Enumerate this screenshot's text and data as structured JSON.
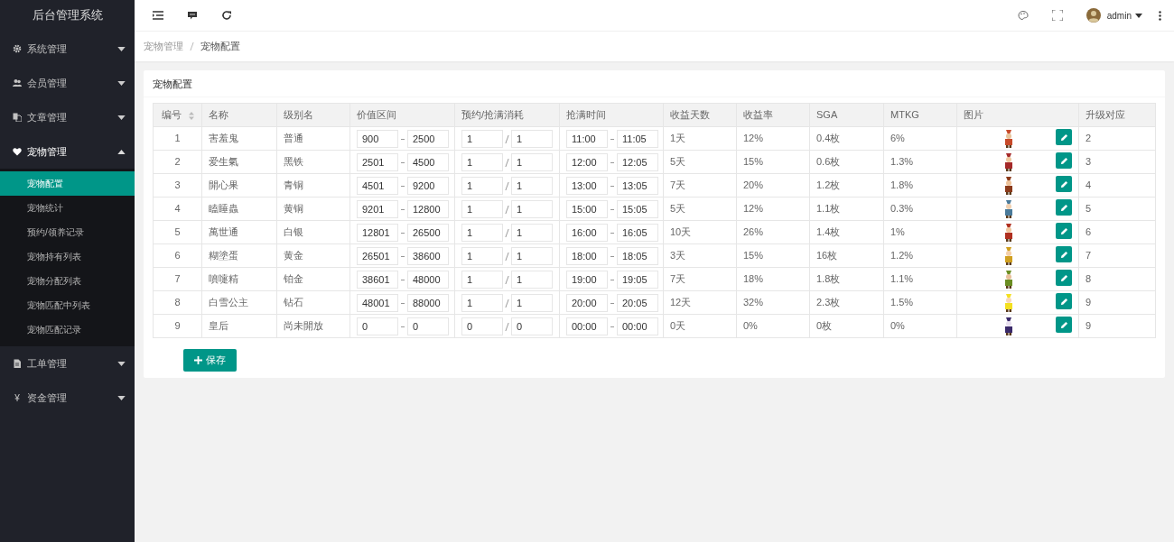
{
  "sidebar": {
    "title": "后台管理系统",
    "items": [
      {
        "label": "系统管理",
        "expanded": false
      },
      {
        "label": "会员管理",
        "expanded": false
      },
      {
        "label": "文章管理",
        "expanded": false
      },
      {
        "label": "宠物管理",
        "expanded": true,
        "children": [
          {
            "label": "宠物配置",
            "selected": true
          },
          {
            "label": "宠物统计",
            "selected": false
          },
          {
            "label": "预约/领养记录",
            "selected": false
          },
          {
            "label": "宠物持有列表",
            "selected": false
          },
          {
            "label": "宠物分配列表",
            "selected": false
          },
          {
            "label": "宠物匹配中列表",
            "selected": false
          },
          {
            "label": "宠物匹配记录",
            "selected": false
          }
        ]
      },
      {
        "label": "工单管理",
        "expanded": false
      },
      {
        "label": "资金管理",
        "expanded": false,
        "icon_text": "¥"
      }
    ]
  },
  "header": {
    "user": "admin"
  },
  "breadcrumb": [
    "宠物管理",
    "宠物配置"
  ],
  "card": {
    "title": "宠物配置",
    "columns": [
      "编号",
      "名称",
      "级别名",
      "价值区间",
      "预约/抢满消耗",
      "抢满时间",
      "收益天数",
      "收益率",
      "SGA",
      "MTKG",
      "图片",
      "升级对应"
    ],
    "rows": [
      {
        "id": "1",
        "name": "害羞鬼",
        "level_name": "普通",
        "price_min": "900",
        "price_max": "2500",
        "cost_reserve": "1",
        "cost_grab": "1",
        "time_start": "11:00",
        "time_end": "11:05",
        "days": "1天",
        "rate": "12%",
        "sga": "0.4枚",
        "mtkg": "6%",
        "upgrade": "2"
      },
      {
        "id": "2",
        "name": "爱生氣",
        "level_name": "黑铁",
        "price_min": "2501",
        "price_max": "4500",
        "cost_reserve": "1",
        "cost_grab": "1",
        "time_start": "12:00",
        "time_end": "12:05",
        "days": "5天",
        "rate": "15%",
        "sga": "0.6枚",
        "mtkg": "1.3%",
        "upgrade": "3"
      },
      {
        "id": "3",
        "name": "開心果",
        "level_name": "青铜",
        "price_min": "4501",
        "price_max": "9200",
        "cost_reserve": "1",
        "cost_grab": "1",
        "time_start": "13:00",
        "time_end": "13:05",
        "days": "7天",
        "rate": "20%",
        "sga": "1.2枚",
        "mtkg": "1.8%",
        "upgrade": "4"
      },
      {
        "id": "4",
        "name": "瞌睡蟲",
        "level_name": "黄铜",
        "price_min": "9201",
        "price_max": "12800",
        "cost_reserve": "1",
        "cost_grab": "1",
        "time_start": "15:00",
        "time_end": "15:05",
        "days": "5天",
        "rate": "12%",
        "sga": "1.1枚",
        "mtkg": "0.3%",
        "upgrade": "5"
      },
      {
        "id": "5",
        "name": "萬世通",
        "level_name": "白银",
        "price_min": "12801",
        "price_max": "26500",
        "cost_reserve": "1",
        "cost_grab": "1",
        "time_start": "16:00",
        "time_end": "16:05",
        "days": "10天",
        "rate": "26%",
        "sga": "1.4枚",
        "mtkg": "1%",
        "upgrade": "6"
      },
      {
        "id": "6",
        "name": "糊塗蛋",
        "level_name": "黄金",
        "price_min": "26501",
        "price_max": "38600",
        "cost_reserve": "1",
        "cost_grab": "1",
        "time_start": "18:00",
        "time_end": "18:05",
        "days": "3天",
        "rate": "15%",
        "sga": "16枚",
        "mtkg": "1.2%",
        "upgrade": "7"
      },
      {
        "id": "7",
        "name": "噴嚏精",
        "level_name": "铂金",
        "price_min": "38601",
        "price_max": "48000",
        "cost_reserve": "1",
        "cost_grab": "1",
        "time_start": "19:00",
        "time_end": "19:05",
        "days": "7天",
        "rate": "18%",
        "sga": "1.8枚",
        "mtkg": "1.1%",
        "upgrade": "8"
      },
      {
        "id": "8",
        "name": "白雪公主",
        "level_name": "钻石",
        "price_min": "48001",
        "price_max": "88000",
        "cost_reserve": "1",
        "cost_grab": "1",
        "time_start": "20:00",
        "time_end": "20:05",
        "days": "12天",
        "rate": "32%",
        "sga": "2.3枚",
        "mtkg": "1.5%",
        "upgrade": "9"
      },
      {
        "id": "9",
        "name": "皇后",
        "level_name": "尚未開放",
        "price_min": "0",
        "price_max": "0",
        "cost_reserve": "0",
        "cost_grab": "0",
        "time_start": "00:00",
        "time_end": "00:00",
        "days": "0天",
        "rate": "0%",
        "sga": "0枚",
        "mtkg": "0%",
        "upgrade": "9"
      }
    ],
    "save_button": "保存"
  }
}
